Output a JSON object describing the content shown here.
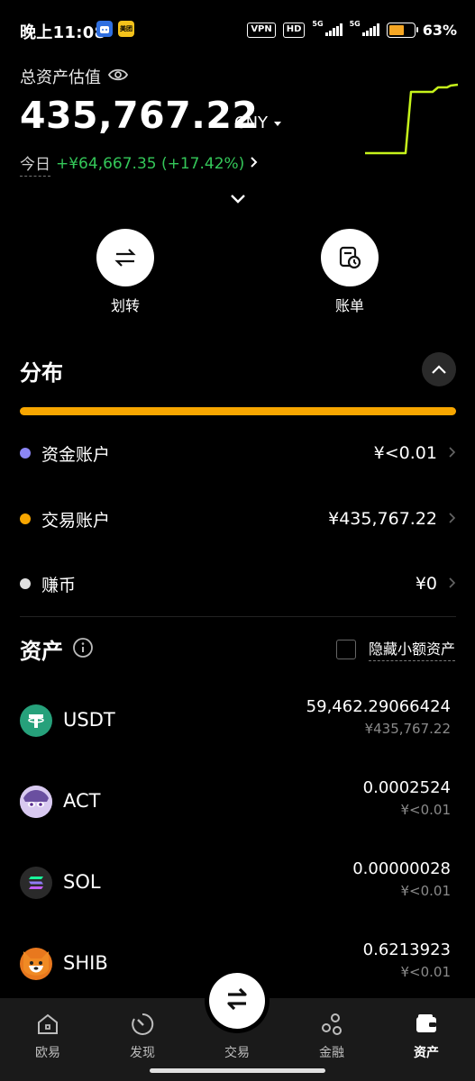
{
  "status_bar": {
    "time": "晚上11:08",
    "app_badge_2": "美团",
    "vpn": "VPN",
    "hd": "HD",
    "net1": "5G",
    "net2": "5G",
    "battery_pct": "63%",
    "battery_level": 0.63
  },
  "header": {
    "title": "总资产估值",
    "amount": "435,767.22",
    "currency": "CNY",
    "today_label": "今日",
    "today_change": "+¥64,667.35 (+17.42%)"
  },
  "actions": [
    {
      "label": "划转",
      "icon": "transfer-arrows-icon"
    },
    {
      "label": "账单",
      "icon": "bill-clock-icon"
    }
  ],
  "distribution": {
    "title": "分布",
    "rows": [
      {
        "name": "资金账户",
        "value": "¥<0.01",
        "color": "#8b86f5"
      },
      {
        "name": "交易账户",
        "value": "¥435,767.22",
        "color": "#f7a600"
      },
      {
        "name": "赚币",
        "value": "¥0",
        "color": "#e0e0e0"
      }
    ]
  },
  "assets": {
    "title": "资产",
    "hide_small_label": "隐藏小额资产",
    "coins": [
      {
        "symbol": "USDT",
        "amount": "59,462.29066424",
        "value": "¥435,767.22",
        "icon": "usdt-icon"
      },
      {
        "symbol": "ACT",
        "amount": "0.0002524",
        "value": "¥<0.01",
        "icon": "act-icon"
      },
      {
        "symbol": "SOL",
        "amount": "0.00000028",
        "value": "¥<0.01",
        "icon": "sol-icon"
      },
      {
        "symbol": "SHIB",
        "amount": "0.6213923",
        "value": "¥<0.01",
        "icon": "shib-icon"
      }
    ]
  },
  "bottom_nav": {
    "items": [
      {
        "label": "欧易",
        "icon": "home-icon"
      },
      {
        "label": "发现",
        "icon": "discover-icon"
      },
      {
        "label": "交易",
        "icon": "trade-icon"
      },
      {
        "label": "金融",
        "icon": "finance-icon"
      },
      {
        "label": "资产",
        "icon": "wallet-icon",
        "active": true
      }
    ]
  },
  "colors": {
    "positive": "#34c759",
    "accent": "#f7a600",
    "chart_line": "#c6f31b"
  }
}
